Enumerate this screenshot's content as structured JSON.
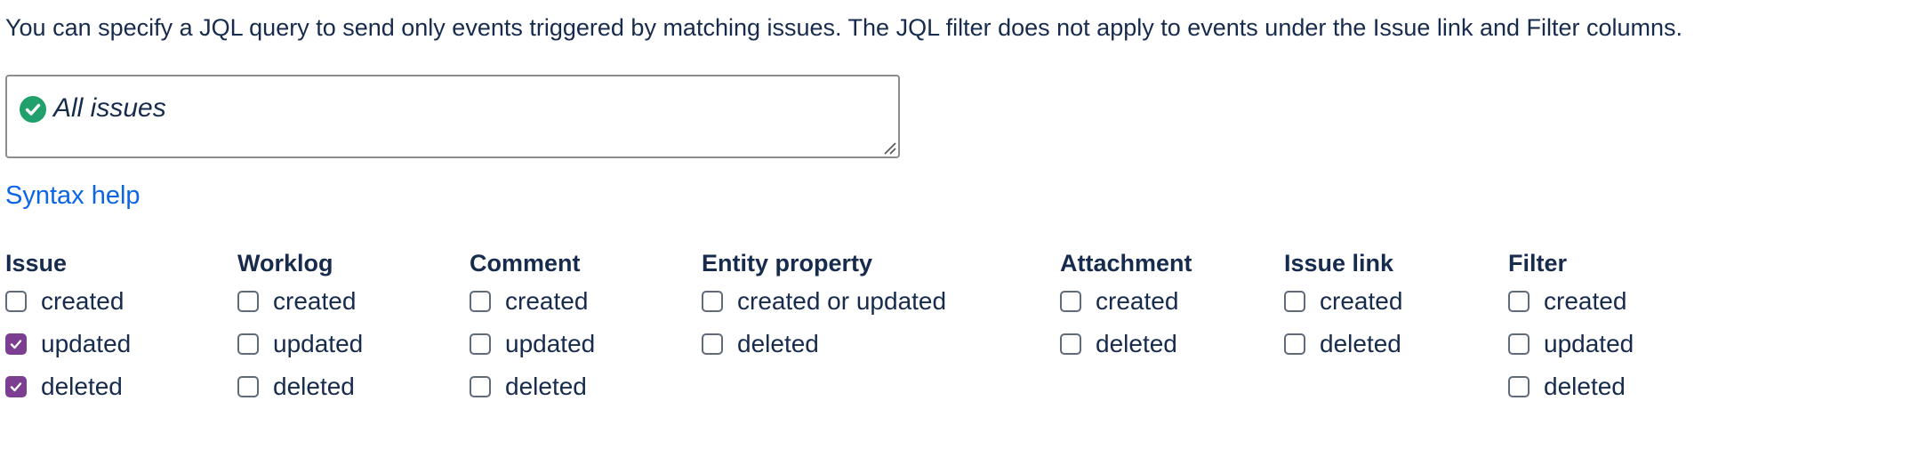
{
  "description": "You can specify a JQL query to send only events triggered by matching issues. The JQL filter does not apply to events under the Issue link and Filter columns.",
  "jql": {
    "value": "All issues",
    "status_icon": "check-circle-icon",
    "status_color": "#22a06b"
  },
  "syntax_help_label": "Syntax help",
  "colors": {
    "checkbox_checked": "#7b3e91",
    "link": "#0c66e4",
    "text": "#172b4d"
  },
  "columns": [
    {
      "heading": "Issue",
      "options": [
        {
          "label": "created",
          "checked": false
        },
        {
          "label": "updated",
          "checked": true
        },
        {
          "label": "deleted",
          "checked": true
        }
      ]
    },
    {
      "heading": "Worklog",
      "options": [
        {
          "label": "created",
          "checked": false
        },
        {
          "label": "updated",
          "checked": false
        },
        {
          "label": "deleted",
          "checked": false
        }
      ]
    },
    {
      "heading": "Comment",
      "options": [
        {
          "label": "created",
          "checked": false
        },
        {
          "label": "updated",
          "checked": false
        },
        {
          "label": "deleted",
          "checked": false
        }
      ]
    },
    {
      "heading": "Entity property",
      "options": [
        {
          "label": "created or updated",
          "checked": false
        },
        {
          "label": "deleted",
          "checked": false
        }
      ]
    },
    {
      "heading": "Attachment",
      "options": [
        {
          "label": "created",
          "checked": false
        },
        {
          "label": "deleted",
          "checked": false
        }
      ]
    },
    {
      "heading": "Issue link",
      "options": [
        {
          "label": "created",
          "checked": false
        },
        {
          "label": "deleted",
          "checked": false
        }
      ]
    },
    {
      "heading": "Filter",
      "options": [
        {
          "label": "created",
          "checked": false
        },
        {
          "label": "updated",
          "checked": false
        },
        {
          "label": "deleted",
          "checked": false
        }
      ]
    }
  ]
}
